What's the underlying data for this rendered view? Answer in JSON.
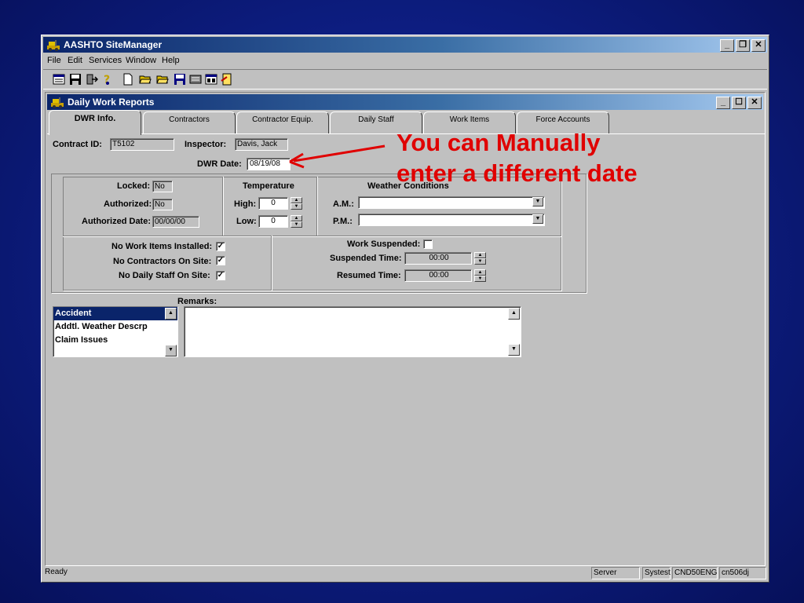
{
  "app": {
    "title": "AASHTO SiteManager",
    "window_buttons": [
      "_",
      "❐",
      "✕"
    ]
  },
  "menu": {
    "items": [
      {
        "label": "File"
      },
      {
        "label": "Edit"
      },
      {
        "label": "Services"
      },
      {
        "label": "Window"
      },
      {
        "label": "Help"
      }
    ]
  },
  "toolbar": {
    "icons": [
      "calendar-icon",
      "save-disk-icon",
      "exit-icon",
      "help-icon",
      "new-document-icon",
      "open-folder-icon",
      "open-folder-2-icon",
      "save-icon",
      "list-icon",
      "report-icon",
      "notes-icon"
    ]
  },
  "child": {
    "title": "Daily Work Reports",
    "window_buttons": [
      "_",
      "☐",
      "✕"
    ]
  },
  "tabs": [
    {
      "label": "DWR Info.",
      "active": true
    },
    {
      "label": "Contractors"
    },
    {
      "label": "Contractor Equip."
    },
    {
      "label": "Daily Staff"
    },
    {
      "label": "Work Items"
    },
    {
      "label": "Force Accounts"
    }
  ],
  "header": {
    "contract_label": "Contract ID:",
    "contract_value": "T5102",
    "inspector_label": "Inspector:",
    "inspector_value": "Davis, Jack",
    "dwr_date_label": "DWR Date:",
    "dwr_date_value": "08/19/08"
  },
  "status_panel": {
    "locked_label": "Locked:",
    "locked_value": "No",
    "authorized_label": "Authorized:",
    "authorized_value": "No",
    "auth_date_label": "Authorized Date:",
    "auth_date_value": "00/00/00"
  },
  "temperature": {
    "heading": "Temperature",
    "high_label": "High:",
    "high_value": "0",
    "low_label": "Low:",
    "low_value": "0"
  },
  "weather": {
    "heading": "Weather Conditions",
    "am_label": "A.M.:",
    "am_value": "",
    "pm_label": "P.M.:",
    "pm_value": ""
  },
  "checks": {
    "no_work_items_label": "No Work Items Installed:",
    "no_work_items": true,
    "no_contractors_label": "No Contractors On Site:",
    "no_contractors": true,
    "no_staff_label": "No Daily Staff On Site:",
    "no_staff": true,
    "check_mark": "✓"
  },
  "suspension": {
    "suspended_label": "Work Suspended:",
    "suspended": false,
    "suspended_time_label": "Suspended Time:",
    "suspended_time": "00:00",
    "resumed_time_label": "Resumed Time:",
    "resumed_time": "00:00"
  },
  "remarks": {
    "label": "Remarks:",
    "categories": [
      "Accident",
      "Addtl. Weather Descrp",
      "Claim Issues"
    ],
    "selected": "Accident",
    "text": ""
  },
  "status_bar": {
    "message": "Ready",
    "cells": [
      "Server",
      "Systest",
      "CND50ENG",
      "cn506dj"
    ]
  },
  "annotation": {
    "line1": "You can Manually",
    "line2": "enter a different date",
    "color": "#e00000"
  }
}
